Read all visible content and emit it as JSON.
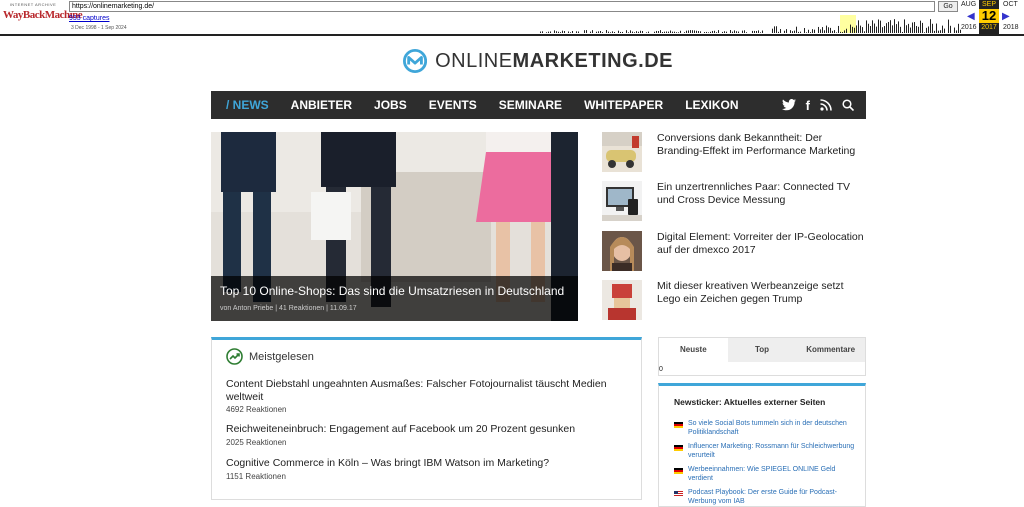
{
  "wayback": {
    "logo_top": "INTERNET ARCHIVE",
    "logo_main": "WayBackMachine",
    "url": "https://onlinemarketing.de/",
    "go_label": "Go",
    "captures": "933 captures",
    "range": "3 Dec 1998 - 1 Sep 2024",
    "month_prev": "AUG",
    "month_cur": "SEP",
    "day": "12",
    "year_cur": "2017",
    "month_next": "OCT",
    "year_prev": "2016",
    "year_next": "2018"
  },
  "logo": {
    "word1": "ONLINE",
    "word2": "MARKETING",
    "word3": ".DE"
  },
  "nav": {
    "items": [
      "/ NEWS",
      "ANBIETER",
      "JOBS",
      "EVENTS",
      "SEMINARE",
      "WHITEPAPER",
      "LEXIKON"
    ],
    "icons": [
      "twitter-icon",
      "facebook-icon",
      "rss-icon",
      "search-icon"
    ]
  },
  "hero": {
    "title": "Top 10 Online-Shops: Das sind die Umsatzriesen in Deutschland",
    "meta": "von Anton Priebe | 41 Reaktionen | 11.09.17"
  },
  "side_articles": [
    "Conversions dank Bekanntheit: Der Branding-Effekt im Performance Marketing",
    "Ein unzertrennliches Paar: Connected TV und Cross Device Messung",
    "Digital Element: Vorreiter der IP-Geolocation auf der dmexco 2017",
    "Mit dieser kreativen Werbeanzeige setzt Lego ein Zeichen gegen Trump"
  ],
  "popular": {
    "heading": "Meistgelesen",
    "items": [
      {
        "title": "Content Diebstahl ungeahnten Ausmaßes: Falscher Fotojournalist täuscht Medien weltweit",
        "reactions": "4692 Reaktionen"
      },
      {
        "title": "Reichweiteneinbruch: Engagement auf Facebook um 20 Prozent gesunken",
        "reactions": "2025 Reaktionen"
      },
      {
        "title": "Cognitive Commerce in Köln – Was bringt IBM Watson im Marketing?",
        "reactions": "1151 Reaktionen"
      }
    ]
  },
  "tabs": {
    "labels": [
      "Neuste",
      "Top",
      "Kommentare"
    ],
    "count": "0"
  },
  "ticker": {
    "heading": "Newsticker: Aktuelles externer Seiten",
    "items": [
      "So viele Social Bots tummeln sich in der deutschen Politiklandschaft",
      "Influencer Marketing: Rossmann für Schleichwerbung verurteilt",
      "Werbeeinnahmen: Wie SPIEGEL ONLINE Geld verdient",
      "Podcast Playbook: Der erste Guide für Podcast-Werbung vom IAB"
    ]
  },
  "colors": {
    "accent": "#3fa6d9",
    "nav_bg": "#2d2d2d"
  }
}
